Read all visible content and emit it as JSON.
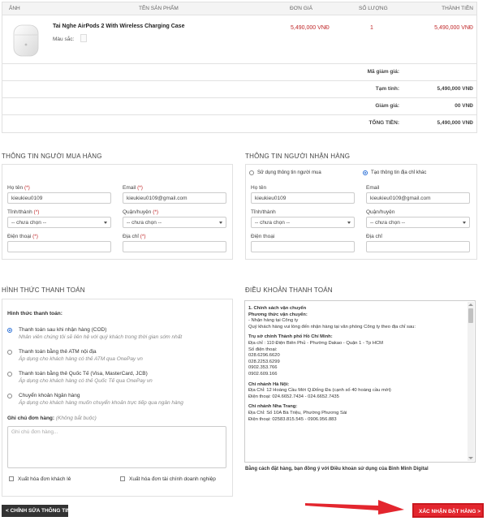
{
  "cart": {
    "headers": {
      "image": "ẢNH",
      "product": "TÊN SẢN PHẨM",
      "price": "ĐƠN GIÁ",
      "qty": "SỐ LƯỢNG",
      "total": "THÀNH TIỀN"
    },
    "item": {
      "name": "Tai Nghe AirPods 2 With Wireless Charging Case",
      "color_label": "Màu sắc:",
      "price": "5,490,000 VNĐ",
      "qty": "1",
      "total": "5,490,000 VNĐ",
      "image_icon": "airpods-case-icon"
    },
    "summary": {
      "coupon_label": "Mã giảm giá:",
      "subtotal_label": "Tạm tính:",
      "subtotal_value": "5,490,000 VNĐ",
      "discount_label": "Giảm giá:",
      "discount_value": "00 VNĐ",
      "grand_label": "TỔNG TIỀN:",
      "grand_value": "5,490,000 VNĐ"
    }
  },
  "buyer": {
    "title": "THÔNG TIN NGƯỜI MUA HÀNG",
    "name_label": "Họ tên",
    "name_value": "kieukieu0109",
    "email_label": "Email",
    "email_value": "kieukieu0109@gmail.com",
    "province_label": "Tỉnh/thành",
    "province_value": "-- chưa chọn --",
    "district_label": "Quận/huyện",
    "district_value": "-- chưa chọn --",
    "phone_label": "Điện thoại",
    "address_label": "Địa chỉ",
    "required_mark": "(*)"
  },
  "receiver": {
    "title": "THÔNG TIN NGƯỜI NHẬN HÀNG",
    "opt_use_buyer": "Sử dụng thông tin người mua",
    "opt_new_address": "Tạo thông tin địa chỉ khác",
    "name_label": "Họ tên",
    "name_value": "kieukieu0109",
    "email_label": "Email",
    "email_value": "kieukieu0109@gmail.com",
    "province_label": "Tỉnh/thành",
    "province_value": "-- chưa chọn --",
    "district_label": "Quận/huyện",
    "district_value": "-- chưa chọn --",
    "phone_label": "Điện thoại",
    "address_label": "Địa chỉ"
  },
  "payment": {
    "title": "HÌNH THỨC THANH TOÁN",
    "subtitle": "Hình thức thanh toán:",
    "options": [
      {
        "label": "Thanh toán sau khi nhận hàng (COD)",
        "desc": "Nhân viên chúng tôi sẽ liên hệ với quý khách trong thời gian sớm nhất"
      },
      {
        "label": "Thanh toán bằng thẻ ATM nội địa",
        "desc": "Áp dụng cho khách hàng có thẻ ATM qua OnePay vn"
      },
      {
        "label": "Thanh toán bằng thẻ Quốc Tế (Visa, MasterCard, JCB)",
        "desc": "Áp dụng cho khách hàng có thẻ Quốc Tế qua OnePay vn"
      },
      {
        "label": "Chuyển khoản Ngân hàng",
        "desc": "Áp dụng cho khách hàng muốn chuyển khoản trực tiếp qua ngân hàng"
      }
    ],
    "note_label": "Ghi chú đơn hàng:",
    "note_optional": "(Không bắt buộc)",
    "note_placeholder": "Ghi chú đơn hàng...",
    "invoice_personal": "Xuất hóa đơn khách lẻ",
    "invoice_company": "Xuất hóa đơn tài chính doanh nghiệp"
  },
  "terms": {
    "title": "ĐIỀU KHOẢN THANH TOÁN",
    "section_heading": "1.    Chính sách vận chuyển",
    "shipping_method": "Phương thức vận chuyển:",
    "receive_at_store": "-  Nhận hàng tại Công ty",
    "receive_desc": "Quý khách hàng vui lòng đến nhận hàng tại văn phòng Công ty theo địa chỉ sau:",
    "hcm_title": "Trụ sở chính Thành phố Hồ Chí Minh:",
    "hcm_address": "Địa chỉ : 110 Điện Biên Phủ - Phường Dakao - Quận 1 - Tp HCM",
    "phone_heading": "Số điện thoại:",
    "hcm_phones": [
      "028.6296.6620",
      "028.2253.6299",
      "0902.353.766",
      "0902.609.166"
    ],
    "hn_title": "Chi nhánh Hà Nội:",
    "hn_address": "Địa Chỉ: 12 Hoàng Cầu Mới Q.Đống Đa (cạnh số 40 hoàng cầu mới)",
    "hn_phone": "Điện thoại: 024.6652.7434 - 024.6652.7435",
    "nt_title": "Chi nhánh Nha Trang:",
    "nt_address": "Địa Chỉ: Số 10A Bà Triệu, Phường Phương Sài",
    "nt_phone": "Điện thoại: 02583.815.545 - 0906.956.883",
    "agree_text": "Bằng cách đặt hàng, bạn đồng ý với Điều khoản sử dụng của Bình Minh Digital"
  },
  "actions": {
    "back": "< CHỈNH SỬA THÔNG TIN",
    "confirm": "XÁC NHẬN ĐẶT HÀNG >"
  },
  "colors": {
    "accent_red": "#e3262e",
    "price_red": "#c0282a"
  }
}
